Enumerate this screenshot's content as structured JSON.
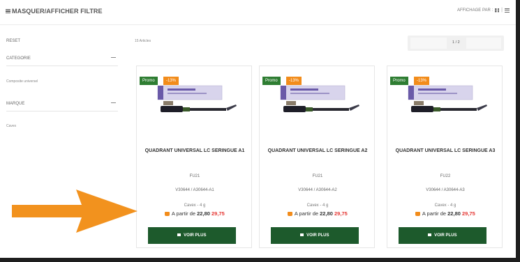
{
  "topbar": {
    "filter_toggle": "MASQUER/AFFICHER FILTRE",
    "view_label": "AFFICHAGE PAR :"
  },
  "sidebar": {
    "reset": "RESET",
    "category_label": "CATEGORIE",
    "category_value": "Composite universel",
    "brand_label": "MARQUE",
    "brand_value": "Cavex"
  },
  "results": {
    "count_text": "15 Articles",
    "page_text": "1 / 2"
  },
  "products": [
    {
      "promo_label": "Promo",
      "discount": "-13%",
      "name": "QUADRANT UNIVERSAL LC SERINGUE A1",
      "code": "FU21",
      "ref": "V30644 / A30644-A1",
      "packaging": "Cavex - 4 g",
      "price_prefix": "A partir de",
      "price_new": "22,80",
      "price_old": "29,75",
      "button_label": "VOIR PLUS"
    },
    {
      "promo_label": "Promo",
      "discount": "-13%",
      "name": "QUADRANT UNIVERSAL LC SERINGUE A2",
      "code": "FU21",
      "ref": "V30644 / A30644-A2",
      "packaging": "Cavex - 4 g",
      "price_prefix": "A partir de",
      "price_new": "22,80",
      "price_old": "29,75",
      "button_label": "VOIR PLUS"
    },
    {
      "promo_label": "Promo",
      "discount": "-13%",
      "name": "QUADRANT UNIVERSAL LC SERINGUE A3",
      "code": "FU22",
      "ref": "V30644 / A30644-A3",
      "packaging": "Cavex - 4 g",
      "price_prefix": "A partir de",
      "price_new": "22,80",
      "price_old": "29,75",
      "button_label": "VOIR PLUS"
    }
  ],
  "colors": {
    "promo_green": "#2e7d32",
    "discount_orange": "#f28c1b",
    "button_green": "#1d5a2c",
    "old_price_red": "#e53935",
    "arrow_orange": "#f2921e"
  }
}
